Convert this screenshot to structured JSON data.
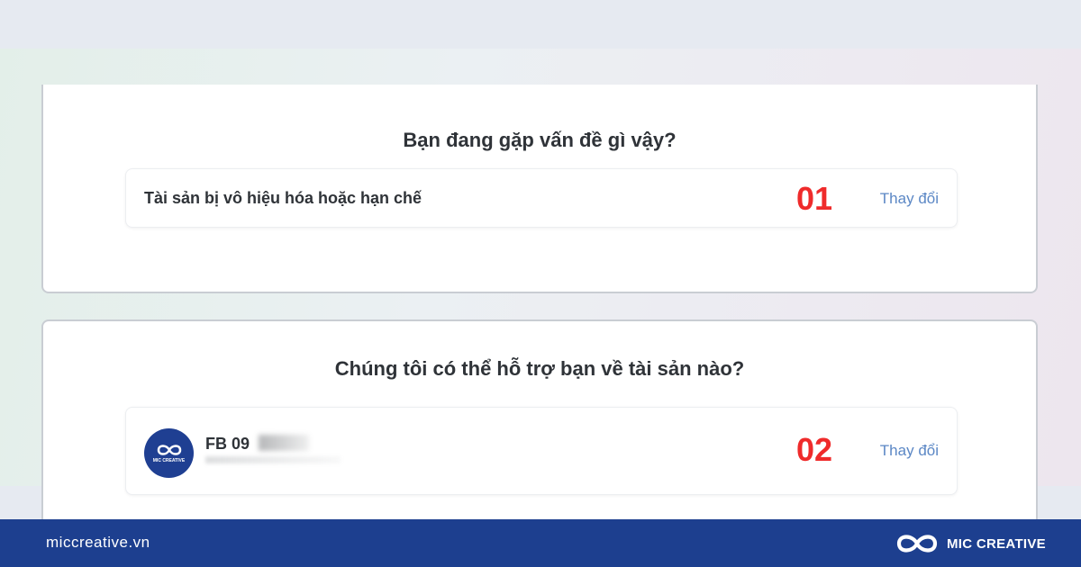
{
  "problem_section": {
    "title": "Bạn đang gặp vấn đề gì vậy?",
    "selected_label": "Tài sản bị vô hiệu hóa hoặc hạn chế",
    "step_number": "01",
    "change_label": "Thay đổi"
  },
  "asset_section": {
    "title": "Chúng tôi có thể hỗ trợ bạn về tài sản nào?",
    "asset_name": "FB 09",
    "avatar_caption": "MIC CREATIVE",
    "step_number": "02",
    "change_label": "Thay đổi"
  },
  "footer": {
    "website": "miccreative.vn",
    "brand_name": "MIC CREATIVE",
    "logo_icon": "infinity-logo-icon"
  },
  "colors": {
    "step_number": "#ef2b2b",
    "link": "#5b87c5",
    "footer_bg": "#1d3f8f",
    "avatar_bg": "#1f3f92"
  }
}
